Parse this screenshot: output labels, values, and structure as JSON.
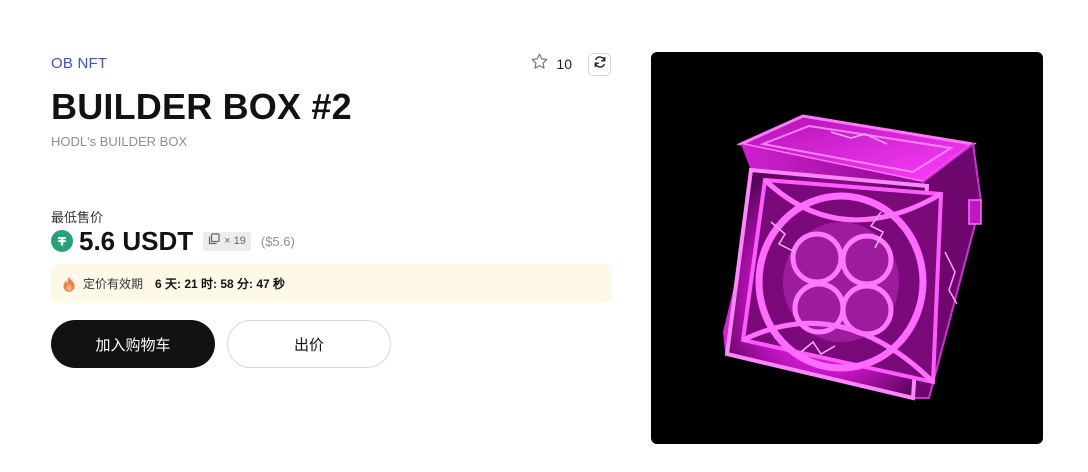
{
  "collection": "OB NFT",
  "favorites_count": "10",
  "item": {
    "title": "BUILDER BOX #2",
    "subtitle": "HODL's BUILDER BOX"
  },
  "pricing": {
    "label": "最低售价",
    "price": "5.6 USDT",
    "quantity": "× 19",
    "usd": "($5.6)",
    "currency_icon": "tether-icon"
  },
  "expiry": {
    "label": "定价有效期",
    "time": "6 天: 21 时: 58 分: 47 秒"
  },
  "actions": {
    "cart": "加入购物车",
    "offer": "出价"
  },
  "colors": {
    "accent": "#3c52c5",
    "tether": "#26a17b",
    "box": "#e020e0"
  }
}
